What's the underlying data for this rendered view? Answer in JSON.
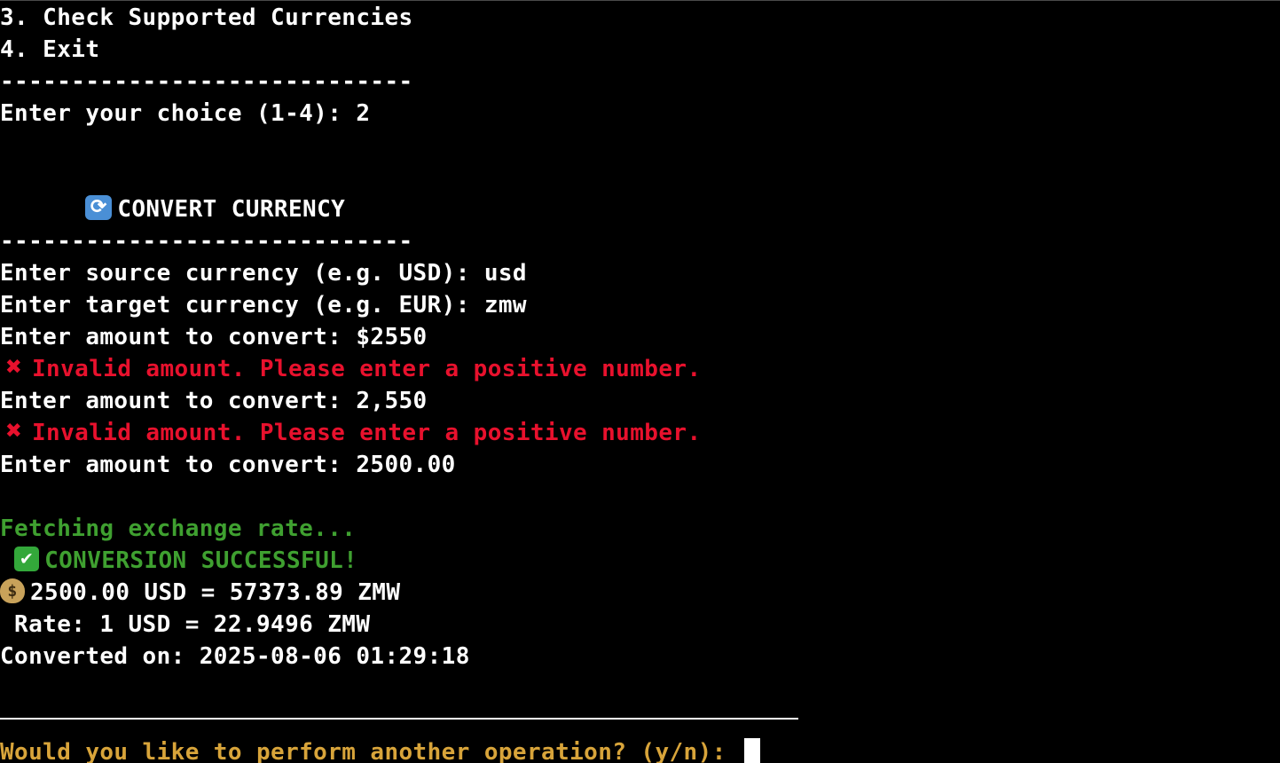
{
  "menu": {
    "option_3": "3. Check Supported Currencies",
    "option_4": "4. Exit",
    "separator": "-----------------------------",
    "choice_prompt": "Enter your choice (1-4): 2"
  },
  "convert": {
    "title_indent": "      ",
    "title": "CONVERT CURRENCY",
    "title_icon": "refresh-icon",
    "separator": "-----------------------------",
    "source_prompt": "Enter source currency (e.g. USD): usd",
    "target_prompt": "Enter target currency (e.g. EUR): zmw",
    "amount_attempt_1": "Enter amount to convert: $2550",
    "error_1": "Invalid amount. Please enter a positive number.",
    "amount_attempt_2": "Enter amount to convert: 2,550",
    "error_2": "Invalid amount. Please enter a positive number.",
    "amount_attempt_3": "Enter amount to convert: 2500.00",
    "error_icon": "cross-icon"
  },
  "result": {
    "fetching": "Fetching exchange rate...",
    "success_prefix": " ",
    "success": "CONVERSION SUCCESSFUL!",
    "success_icon": "check-icon",
    "conversion": "2500.00 USD = 57373.89 ZMW",
    "conversion_icon": "money-bag-icon",
    "rate": " Rate: 1 USD = 22.9496 ZMW",
    "timestamp": "Converted on: 2025-08-06 01:29:18"
  },
  "footer": {
    "prompt": "Would you like to perform another operation? (y/n): "
  },
  "colors": {
    "background": "#000000",
    "text": "#ffffff",
    "error": "#e8112d",
    "success": "#3fa030",
    "prompt": "#d8a43a"
  }
}
